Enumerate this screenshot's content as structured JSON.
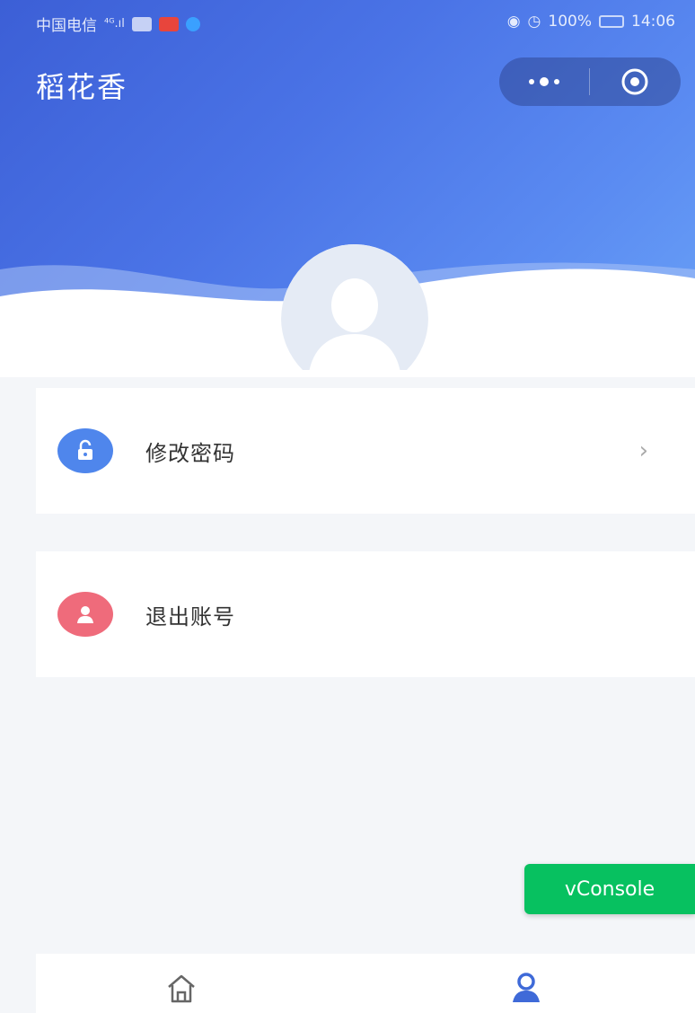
{
  "status_bar": {
    "carrier": "中国电信",
    "signal": "⁴ᴳ.ıl",
    "battery": "100%",
    "time": "14:06"
  },
  "app": {
    "title": "稻花香"
  },
  "capsule": {
    "more_icon": "more-dots-icon",
    "close_icon": "target-circle-icon"
  },
  "menu": {
    "items": [
      {
        "label": "修改密码",
        "icon": "unlock-icon",
        "color": "#4f86ec",
        "has_arrow": true
      },
      {
        "label": "退出账号",
        "icon": "user-icon",
        "color": "#ef6b7b",
        "has_arrow": false
      }
    ]
  },
  "vconsole": {
    "label": "vConsole",
    "color": "#07c160"
  },
  "tabbar": {
    "tabs": [
      {
        "icon": "home-icon",
        "active": false
      },
      {
        "icon": "profile-icon",
        "active": true,
        "color": "#3f6ad8"
      }
    ]
  },
  "colors": {
    "header_start": "#3c5fd6",
    "header_end": "#6aa2f6",
    "background": "#f4f6f9"
  }
}
